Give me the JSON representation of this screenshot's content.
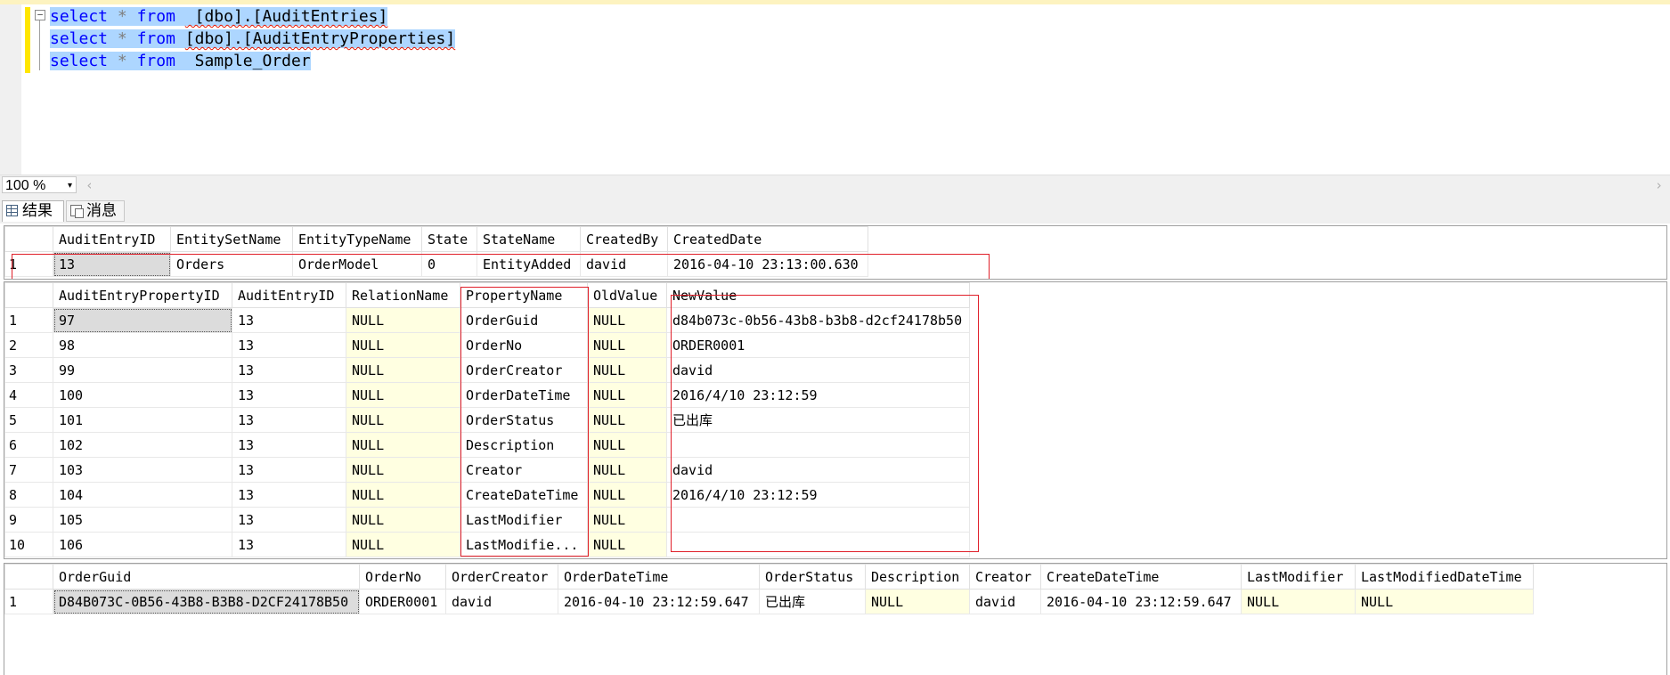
{
  "editor": {
    "lines": [
      {
        "kw1": "select",
        "op": "*",
        "kw2": "from",
        "ident": " [dbo].[AuditEntries]"
      },
      {
        "kw1": "select",
        "op": "*",
        "kw2": "from",
        "ident": "[dbo].[AuditEntryProperties]"
      },
      {
        "kw1": "select",
        "op": "*",
        "kw2": "from",
        "ident": " Sample_Order"
      }
    ],
    "collapse_glyph": "−"
  },
  "zoom": {
    "value": "100 %",
    "arrow": "▾",
    "scroll_left": "‹",
    "scroll_right": "›"
  },
  "tabs": {
    "results": "结果",
    "messages": "消息"
  },
  "grid1": {
    "columns": [
      "AuditEntryID",
      "EntitySetName",
      "EntityTypeName",
      "State",
      "StateName",
      "CreatedBy",
      "CreatedDate"
    ],
    "rows": [
      {
        "n": "1",
        "cells": [
          "13",
          "Orders",
          "OrderModel",
          "0",
          "EntityAdded",
          "david",
          "2016-04-10 23:13:00.630"
        ]
      }
    ]
  },
  "grid2": {
    "columns": [
      "AuditEntryPropertyID",
      "AuditEntryID",
      "RelationName",
      "PropertyName",
      "OldValue",
      "NewValue"
    ],
    "rows": [
      {
        "n": "1",
        "cells": [
          "97",
          "13",
          "NULL",
          "OrderGuid",
          "NULL",
          "d84b073c-0b56-43b8-b3b8-d2cf24178b50"
        ]
      },
      {
        "n": "2",
        "cells": [
          "98",
          "13",
          "NULL",
          "OrderNo",
          "NULL",
          "ORDER0001"
        ]
      },
      {
        "n": "3",
        "cells": [
          "99",
          "13",
          "NULL",
          "OrderCreator",
          "NULL",
          "david"
        ]
      },
      {
        "n": "4",
        "cells": [
          "100",
          "13",
          "NULL",
          "OrderDateTime",
          "NULL",
          "2016/4/10 23:12:59"
        ]
      },
      {
        "n": "5",
        "cells": [
          "101",
          "13",
          "NULL",
          "OrderStatus",
          "NULL",
          "已出库"
        ]
      },
      {
        "n": "6",
        "cells": [
          "102",
          "13",
          "NULL",
          "Description",
          "NULL",
          ""
        ]
      },
      {
        "n": "7",
        "cells": [
          "103",
          "13",
          "NULL",
          "Creator",
          "NULL",
          "david"
        ]
      },
      {
        "n": "8",
        "cells": [
          "104",
          "13",
          "NULL",
          "CreateDateTime",
          "NULL",
          "2016/4/10 23:12:59"
        ]
      },
      {
        "n": "9",
        "cells": [
          "105",
          "13",
          "NULL",
          "LastModifier",
          "NULL",
          ""
        ]
      },
      {
        "n": "10",
        "cells": [
          "106",
          "13",
          "NULL",
          "LastModifie...",
          "NULL",
          ""
        ]
      }
    ]
  },
  "grid3": {
    "columns": [
      "OrderGuid",
      "OrderNo",
      "OrderCreator",
      "OrderDateTime",
      "OrderStatus",
      "Description",
      "Creator",
      "CreateDateTime",
      "LastModifier",
      "LastModifiedDateTime"
    ],
    "rows": [
      {
        "n": "1",
        "cells": [
          "D84B073C-0B56-43B8-B3B8-D2CF24178B50",
          "ORDER0001",
          "david",
          "2016-04-10 23:12:59.647",
          "已出库",
          "NULL",
          "david",
          "2016-04-10 23:12:59.647",
          "NULL",
          "NULL"
        ]
      }
    ]
  }
}
